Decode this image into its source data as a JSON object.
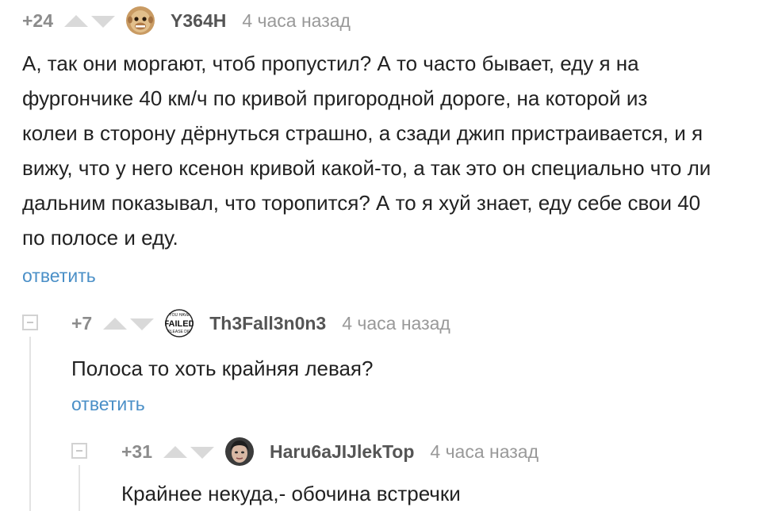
{
  "comments": [
    {
      "rating": "+24",
      "username": "Y364H",
      "time": "4 часа назад",
      "lines": [
        "А, так они моргают, чтоб пропустил? А то часто бывает, еду я на",
        "фургончике 40 км/ч по кривой пригородной дороге, на которой из",
        "колеи в сторону дёрнуться страшно, а сзади джип пристраивается, и я",
        "вижу, что у него ксенон кривой какой-то, а так это он специально что ли",
        "дальним показывал, что торопится? А то я хуй знает, еду себе свои 40",
        "по полосе и еду."
      ],
      "reply": "ответить"
    },
    {
      "rating": "+7",
      "username": "Th3Fall3n0n3",
      "time": "4 часа назад",
      "avatar_text": [
        "YOU HAVE",
        "FAILED",
        "PLEASE DIE"
      ],
      "text": "Полоса то хоть крайняя левая?",
      "reply": "ответить"
    },
    {
      "rating": "+31",
      "username": "Haru6aJIJlekTop",
      "time": "4 часа назад",
      "text": "Крайнее некуда,- обочина встречки"
    }
  ],
  "colors": {
    "accent": "#4a8fc7",
    "muted": "#999999",
    "vote": "#d9d9d9"
  }
}
